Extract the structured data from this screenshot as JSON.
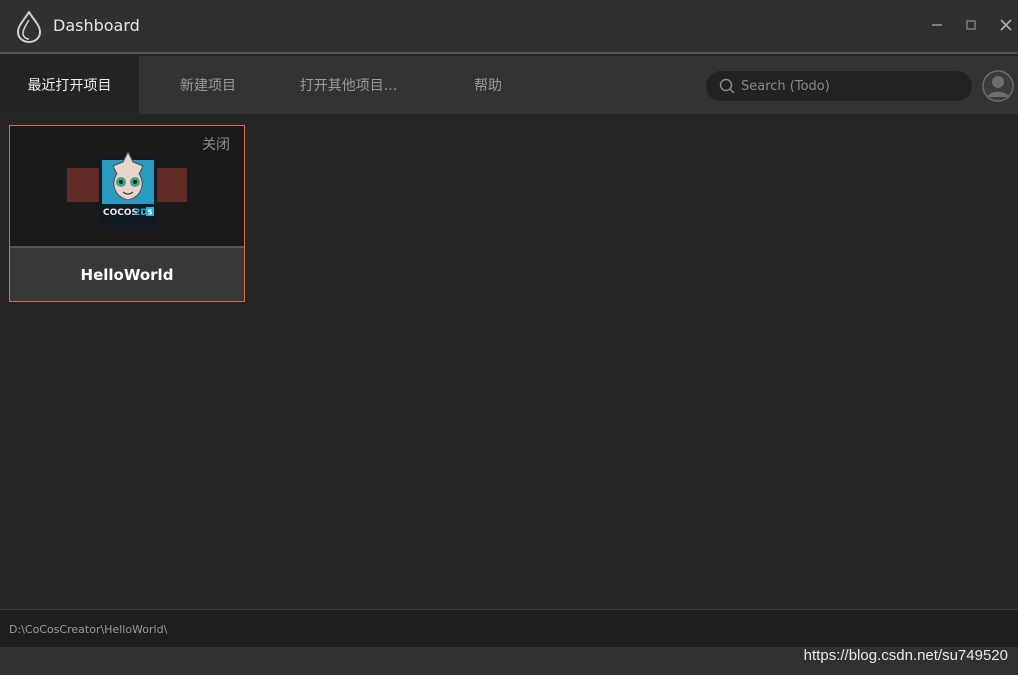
{
  "window": {
    "title": "Dashboard",
    "controls": [
      "minimize-icon",
      "maximize-icon",
      "close-icon"
    ]
  },
  "nav": {
    "tabs": [
      {
        "label": "最近打开项目",
        "active": true
      },
      {
        "label": "新建项目",
        "active": false
      },
      {
        "label": "打开其他项目...",
        "active": false
      },
      {
        "label": "帮助",
        "active": false
      }
    ],
    "search": {
      "placeholder": "Search (Todo)",
      "value": ""
    }
  },
  "projects": [
    {
      "name": "HelloWorld",
      "close_label": "关闭",
      "thumbnail": "cocos2d-logo"
    }
  ],
  "status": {
    "path": "D:\\CoCosCreator\\HelloWorld\\"
  },
  "watermark": "https://blog.csdn.net/su749520",
  "colors": {
    "accent_border": "#e06a55",
    "background": "#252525",
    "titlebar": "#303030"
  }
}
